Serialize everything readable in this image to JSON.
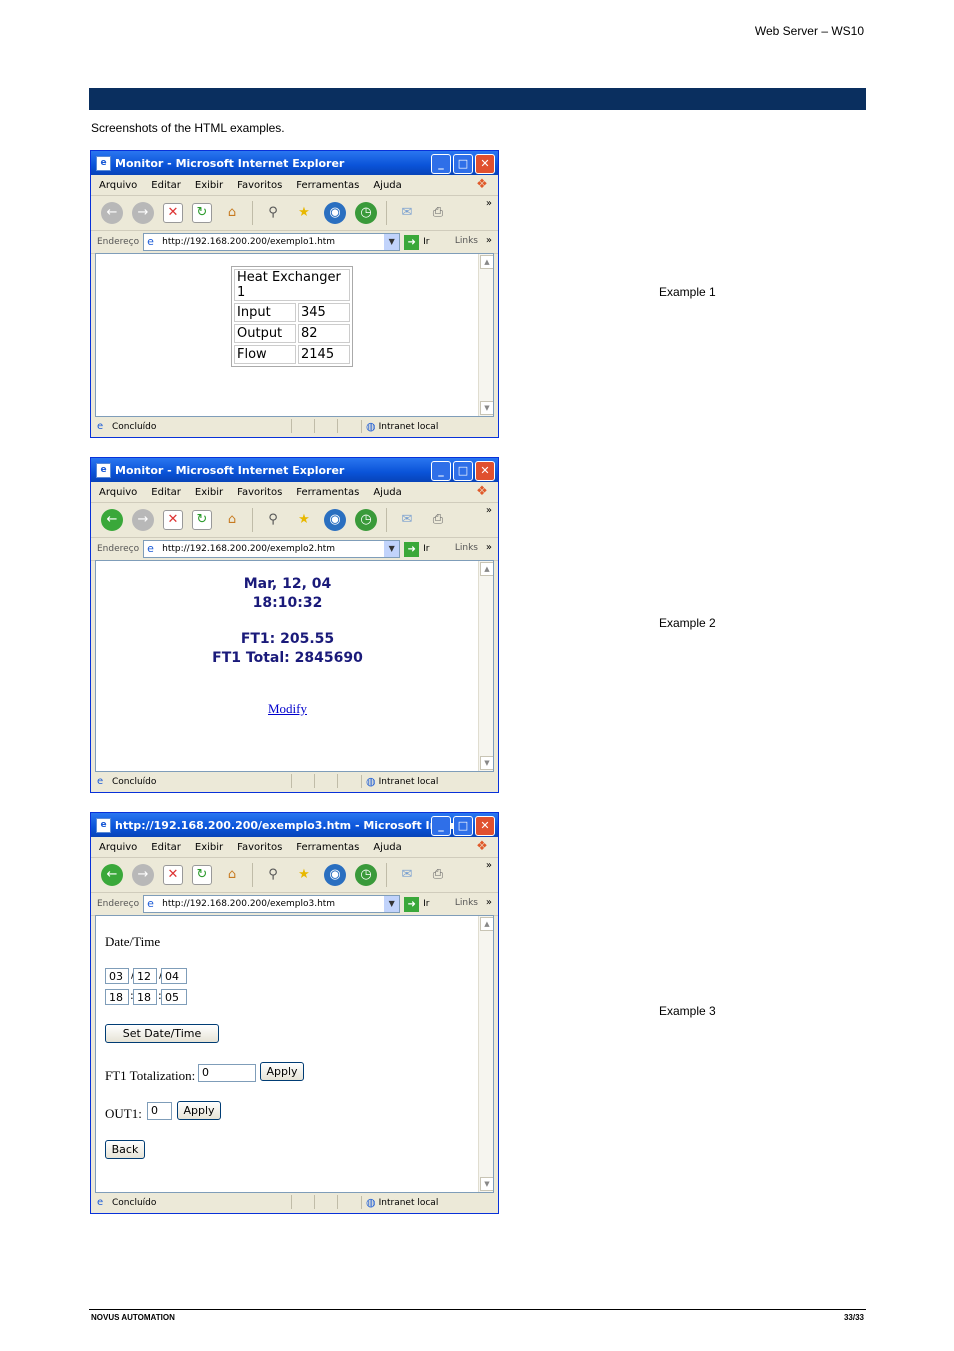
{
  "header": {
    "doc_title": "Web Server – WS10"
  },
  "intro": "Screenshots of the HTML examples.",
  "browser": {
    "menu": [
      "Arquivo",
      "Editar",
      "Exibir",
      "Favoritos",
      "Ferramentas",
      "Ajuda"
    ],
    "address_label": "Endereço",
    "go_label": "Ir",
    "links_label": "Links",
    "status": "Concluído",
    "zone": "Intranet local"
  },
  "examples": [
    {
      "title": "Monitor - Microsoft Internet Explorer",
      "url": "http://192.168.200.200/exemplo1.htm",
      "caption": "Example 1",
      "table": {
        "heading": "Heat Exchanger 1",
        "rows": [
          {
            "label": "Input",
            "value": "345"
          },
          {
            "label": "Output",
            "value": "82"
          },
          {
            "label": "Flow",
            "value": "2145"
          }
        ]
      }
    },
    {
      "title": "Monitor - Microsoft Internet Explorer",
      "url": "http://192.168.200.200/exemplo2.htm",
      "caption": "Example 2",
      "date": "Mar, 12, 04",
      "time": "18:10:32",
      "ft1": "FT1: 205.55",
      "ft1_total": "FT1 Total: 2845690",
      "link": "Modify"
    },
    {
      "title": "http://192.168.200.200/exemplo3.htm - Microsoft Inter…",
      "url": "http://192.168.200.200/exemplo3.htm",
      "caption": "Example 3",
      "date_label": "Date/Time",
      "day": "03",
      "month": "12",
      "year": "04",
      "hour": "18",
      "minute": "18",
      "second": "05",
      "set_button": "Set Date/Time",
      "ft1_label": "FT1 Totalization:",
      "ft1_value": "0",
      "apply": "Apply",
      "out1_label": "OUT1:",
      "out1_value": "0",
      "back": "Back"
    }
  ],
  "footer": {
    "company": "NOVUS AUTOMATION",
    "page": "33/33"
  }
}
